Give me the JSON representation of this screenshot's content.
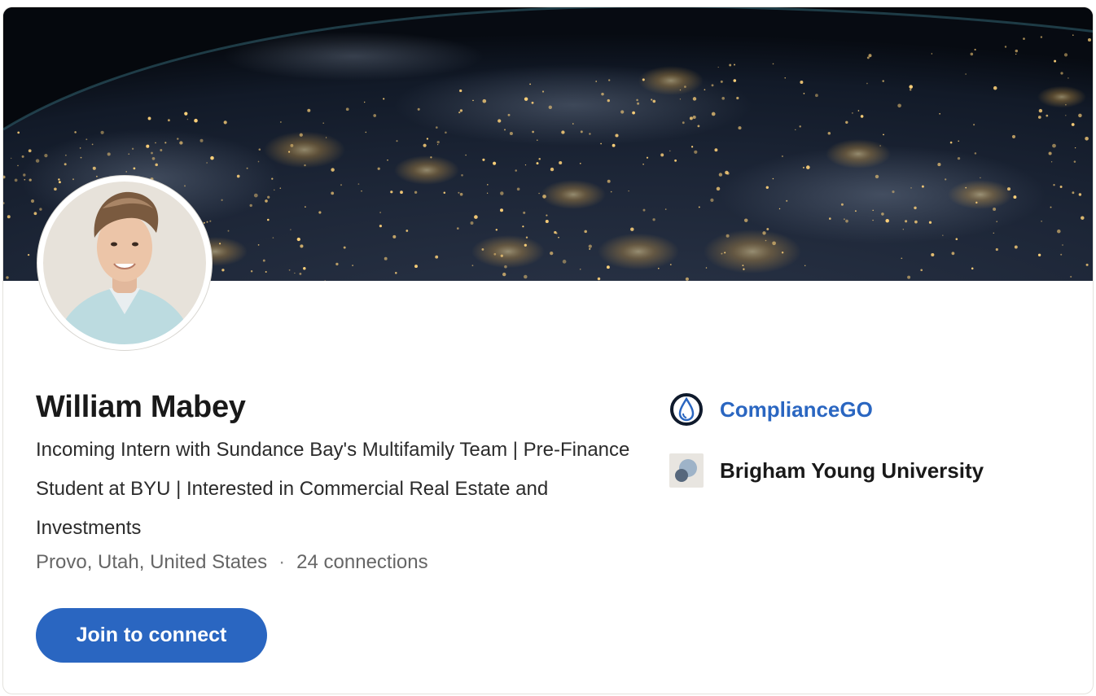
{
  "profile": {
    "name": "William Mabey",
    "headline": "Incoming Intern with Sundance Bay's Multifamily Team | Pre-Finance Student at BYU | Interested in Commercial Real Estate and Investments",
    "location": "Provo, Utah, United States",
    "separator": "·",
    "connections": "24 connections"
  },
  "actions": {
    "join_label": "Join to connect"
  },
  "organizations": [
    {
      "name": "ComplianceGO",
      "icon": "compliancego-logo-icon"
    },
    {
      "name": "Brigham Young University",
      "icon": "university-logo-icon"
    }
  ],
  "colors": {
    "accent": "#2a66c1",
    "text_primary": "#191919",
    "text_secondary": "#666666",
    "cover_dark": "#0a1322",
    "city_lights": "#ffd27a"
  },
  "icons": {
    "cover": "earth-at-night-image",
    "avatar": "profile-photo"
  }
}
